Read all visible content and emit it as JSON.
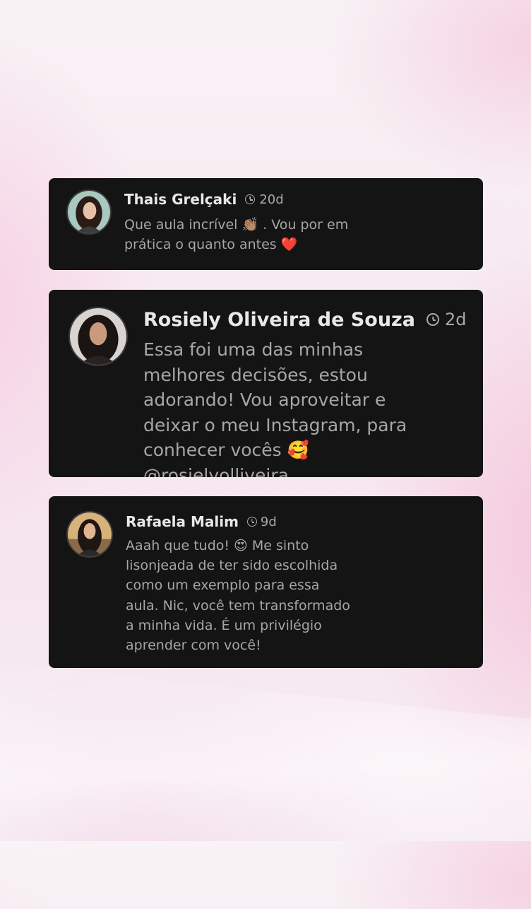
{
  "comments": [
    {
      "name": "Thais Grelçaki",
      "time": "20d",
      "text": "Que aula incrível 👏🏽 . Vou por em\nprática o quanto antes ❤️"
    },
    {
      "name": "Rosiely Oliveira de Souza",
      "time": "2d",
      "text": "Essa foi uma das minhas\nmelhores decisões, estou\nadorando! Vou aproveitar e\ndeixar o meu Instagram, para\nconhecer vocês 🥰\n@rosielyolliveira"
    },
    {
      "name": "Rafaela Malim",
      "time": "9d",
      "text": "Aaah que tudo! 😍 Me sinto\nlisonjeada de ter sido escolhida\ncomo um exemplo para essa\naula. Nic, você tem transformado\na minha vida. É um privilégio\naprender com você!"
    }
  ],
  "icons": {
    "clock": "clock-icon",
    "avatar": "avatar"
  },
  "colors": {
    "card_background": "#141414",
    "name_text": "#e8e8e8",
    "body_text": "#a6a6a6",
    "page_background": "#f7e9f0"
  }
}
